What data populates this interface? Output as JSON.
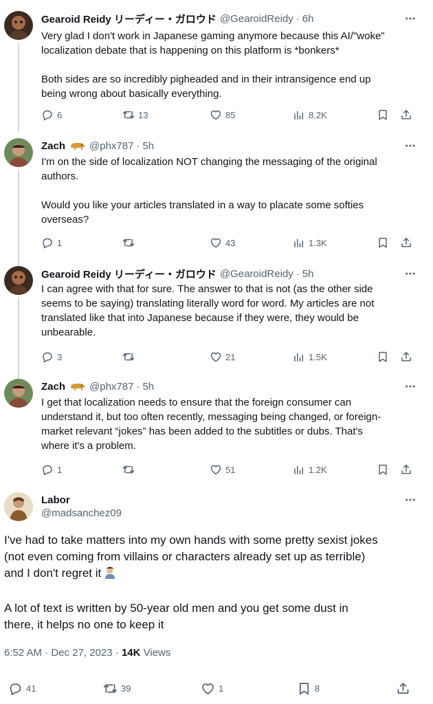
{
  "tweets": [
    {
      "name": "Gearoid Reidy リーディー・ガロウド",
      "handle": "@GearoidReidy",
      "time": "6h",
      "paragraphs": [
        "Very glad I don't work in Japanese gaming anymore because this AI/\"woke\"\nlocalization debate that is happening on this platform is *bonkers*",
        "Both sides are so incredibly pigheaded and in their intransigence end up\nbeing wrong about basically everything."
      ],
      "replies": "6",
      "reposts": "13",
      "likes": "85",
      "views": "8.2K"
    },
    {
      "name": "Zach",
      "handle": "@phx787",
      "time": "5h",
      "paragraphs": [
        "I'm on the side of localization NOT changing the messaging of the original\nauthors.",
        "Would you like your articles translated in a way to placate some softies\noverseas?"
      ],
      "replies": "1",
      "reposts": "",
      "likes": "43",
      "views": "1.3K"
    },
    {
      "name": "Gearoid Reidy リーディー・ガロウド",
      "handle": "@GearoidReidy",
      "time": "5h",
      "paragraphs": [
        "I can agree with that for sure. The answer to that is not (as the other side\nseems to be saying) translating literally word for word. My articles are not\ntranslated like that into Japanese because if they were, they would be\nunbearable."
      ],
      "replies": "3",
      "reposts": "",
      "likes": "21",
      "views": "1.5K"
    },
    {
      "name": "Zach",
      "handle": "@phx787",
      "time": "5h",
      "paragraphs": [
        "I get that localization needs to ensure that the foreign consumer can\nunderstand it, but too often recently, messaging being changed, or foreign-\nmarket relevant “jokes” has been added to the subtitles or dubs. That's\nwhere it's a problem."
      ],
      "replies": "1",
      "reposts": "",
      "likes": "51",
      "views": "1.2K"
    }
  ],
  "main": {
    "name": "Labor",
    "handle": "@madsanchez09",
    "paragraphs": [
      "I've had to take matters into my own hands with some pretty sexist jokes\n(not even coming from villains or characters already set up as terrible)\nand I don't regret it",
      "A lot of text is written by 50-year old men and you get some dust in\nthere, it helps no one to keep it"
    ],
    "timestamp": "6:52 AM · Dec 27, 2023 · ",
    "views_count": "14K",
    "views_label": " Views",
    "replies": "41",
    "reposts": "39",
    "likes": "1",
    "bookmarks": "8"
  },
  "dot": "·",
  "colors": {
    "text": "#0f1419",
    "secondary": "#536471",
    "thread_line": "#cfd9de",
    "separator": "#eff3f4"
  },
  "icons": [
    "reply-icon",
    "repost-icon",
    "like-icon",
    "views-icon",
    "bookmark-icon",
    "share-icon",
    "more-icon",
    "dog-emoji",
    "facepalm-emoji"
  ]
}
